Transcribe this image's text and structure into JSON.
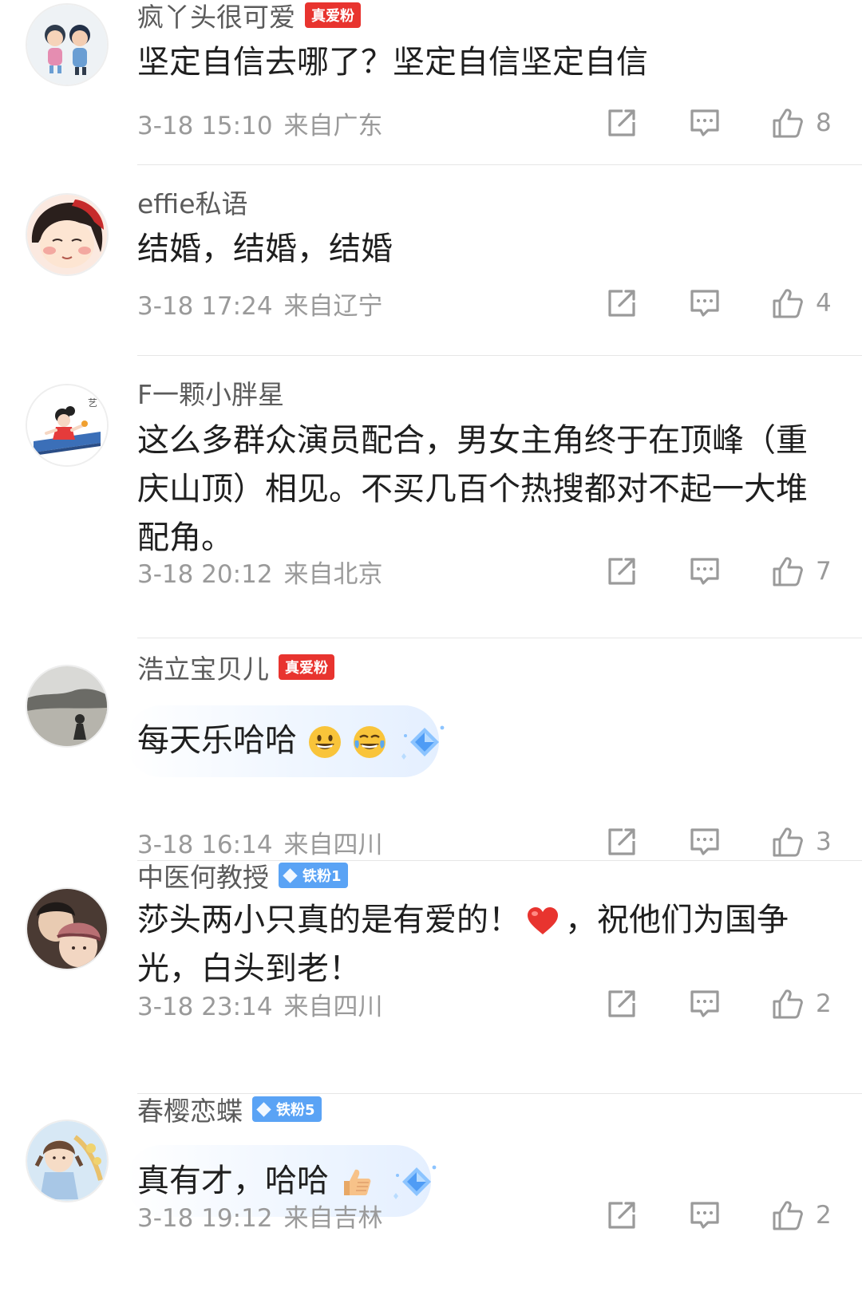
{
  "comments": [
    {
      "username": "疯丫头很可爱",
      "badge": "真爱粉",
      "text": "坚定自信去哪了？坚定自信坚定自信",
      "time": "3-18 15:10",
      "location": "来自广东",
      "likes": "8"
    },
    {
      "username": "effie私语",
      "text": "结婚，结婚，结婚",
      "time": "3-18 17:24",
      "location": "来自辽宁",
      "likes": "4"
    },
    {
      "username": "F一颗小胖星",
      "text_lines": [
        "这么多群众演员配合，男女主角终于在顶峰（重",
        "庆山顶）相见。不买几百个热搜都对不起一大堆",
        "配角。"
      ],
      "time": "3-18 20:12",
      "location": "来自北京",
      "likes": "7"
    },
    {
      "username": "浩立宝贝儿",
      "badge": "真爱粉",
      "text": "每天乐哈哈",
      "text_emojis": [
        "grinning-face-emoji",
        "tears-of-joy-emoji"
      ],
      "time": "3-18 16:14",
      "location": "来自四川",
      "likes": "3"
    },
    {
      "username": "中医何教授",
      "badge": "铁粉1",
      "text_line1_a": "莎头两小只真的是有爱的！",
      "text_line1_b": "，祝他们为国争",
      "text_line1_emoji": "red-heart-emoji",
      "text_line2": "光，白头到老！",
      "time": "3-18 23:14",
      "location": "来自四川",
      "likes": "2"
    },
    {
      "username": "春樱恋蝶",
      "badge": "铁粉5",
      "text": "真有才，哈哈",
      "text_emojis": [
        "thumbs-up-emoji"
      ],
      "time": "3-18 19:12",
      "location": "来自吉林",
      "likes": "2"
    }
  ],
  "icons": {
    "share": "share-icon",
    "reply": "reply-icon",
    "like": "thumbs-up-icon"
  },
  "colors": {
    "badge_red": "#e8342f",
    "badge_blue": "#5aa3f5",
    "meta_gray": "#9a9a9a"
  }
}
